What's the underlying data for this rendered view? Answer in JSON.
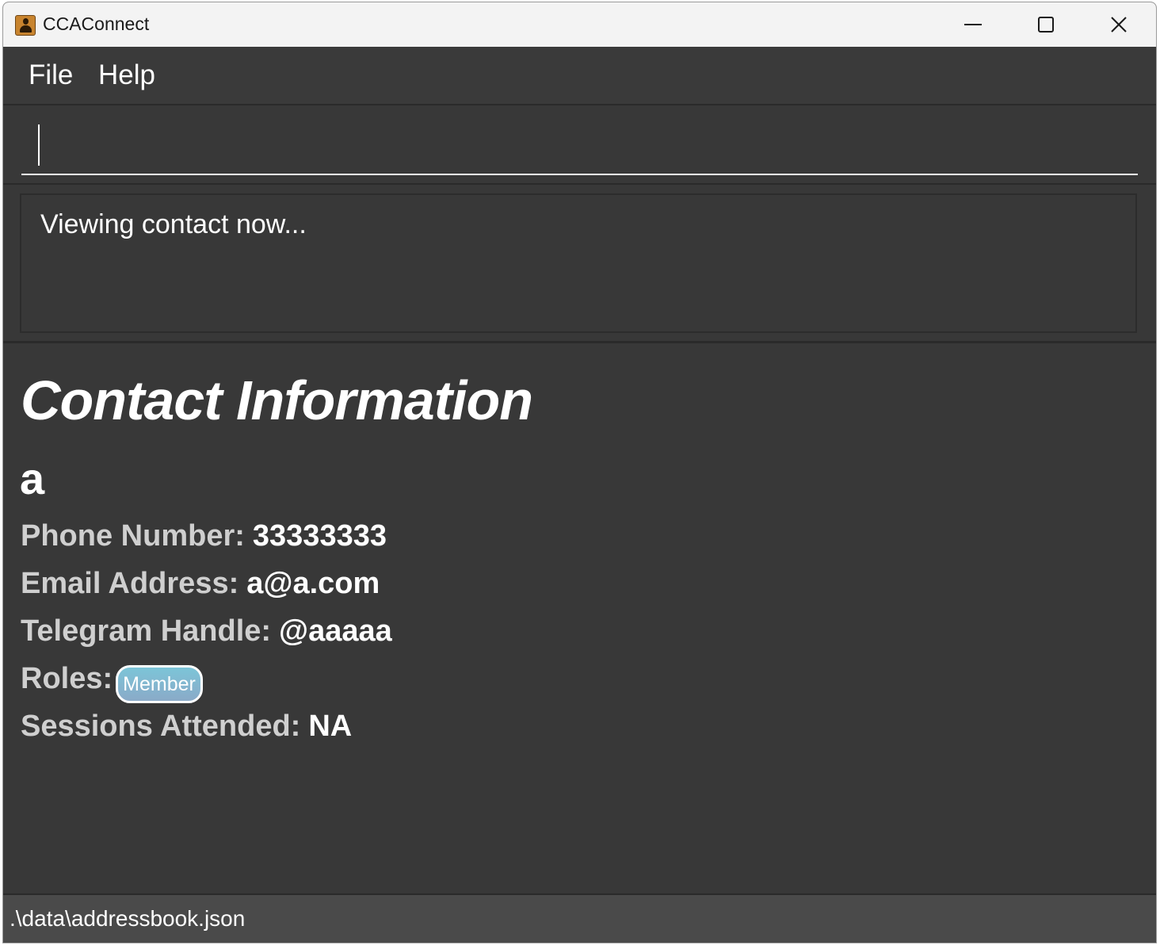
{
  "window": {
    "title": "CCAConnect",
    "icon": "contact-book-icon"
  },
  "menu": {
    "items": [
      {
        "label": "File"
      },
      {
        "label": "Help"
      }
    ]
  },
  "command": {
    "value": ""
  },
  "result": {
    "message": "Viewing contact now..."
  },
  "contact": {
    "heading": "Contact Information",
    "name": "a",
    "phone_label": "Phone Number:",
    "phone": "33333333",
    "email_label": "Email Address:",
    "email": "a@a.com",
    "telegram_label": "Telegram Handle:",
    "telegram": "@aaaaa",
    "roles_label": "Roles:",
    "roles": [
      "Member"
    ],
    "sessions_label": "Sessions Attended:",
    "sessions": "NA"
  },
  "status": {
    "path": ".\\data\\addressbook.json"
  },
  "colors": {
    "background": "#383838",
    "titlebar": "#f3f3f3",
    "statusbar": "#4a4a4a",
    "role_badge": "#7cc5d8",
    "label_text": "#cfcfcf",
    "value_text": "#ffffff"
  }
}
